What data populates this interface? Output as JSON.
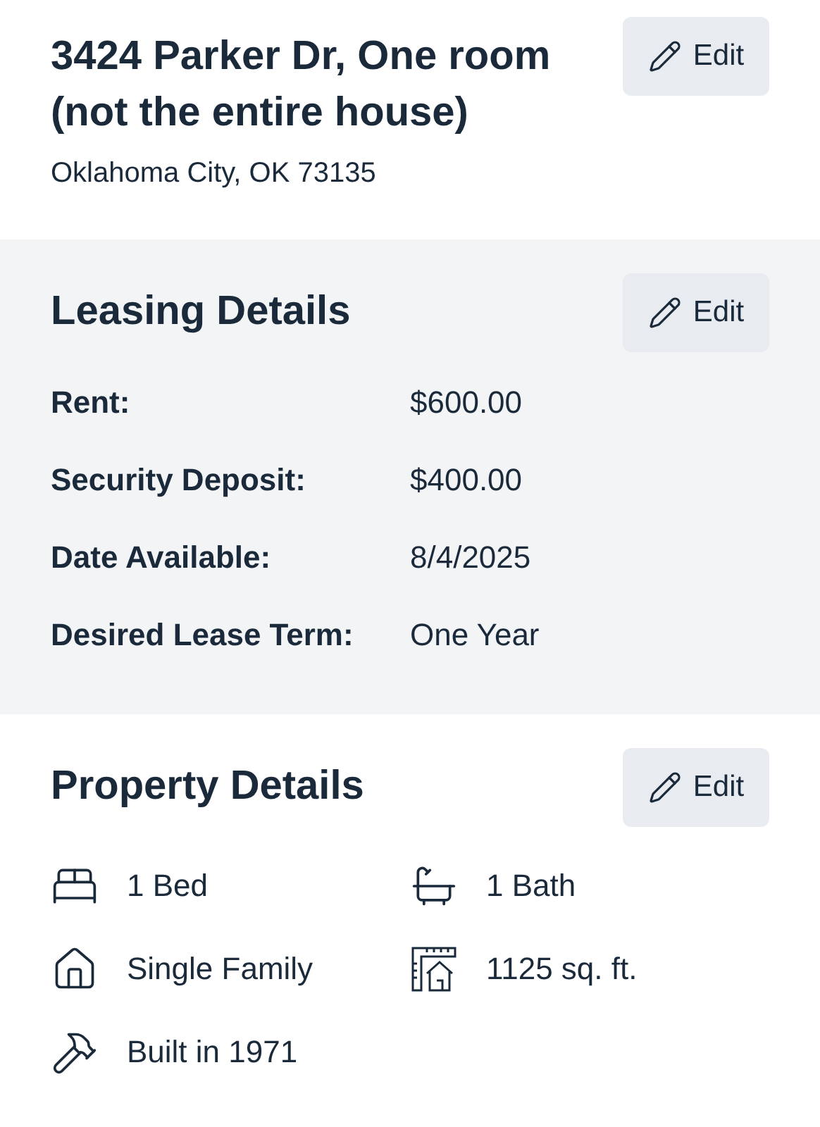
{
  "address": {
    "title": "3424 Parker Dr, One room (not the entire house)",
    "city": "Oklahoma City, OK 73135",
    "edit": "Edit"
  },
  "leasing": {
    "title": "Leasing Details",
    "edit": "Edit",
    "rows": [
      {
        "label": "Rent:",
        "value": "$600.00"
      },
      {
        "label": "Security Deposit:",
        "value": "$400.00"
      },
      {
        "label": "Date Available:",
        "value": "8/4/2025"
      },
      {
        "label": "Desired Lease Term:",
        "value": "One Year"
      }
    ]
  },
  "property": {
    "title": "Property Details",
    "edit": "Edit",
    "features": [
      {
        "kind": "bed",
        "text": "1 Bed"
      },
      {
        "kind": "bath",
        "text": "1 Bath"
      },
      {
        "kind": "home",
        "text": "Single Family"
      },
      {
        "kind": "area",
        "text": "1125 sq. ft."
      },
      {
        "kind": "built",
        "text": "Built in 1971"
      }
    ]
  }
}
